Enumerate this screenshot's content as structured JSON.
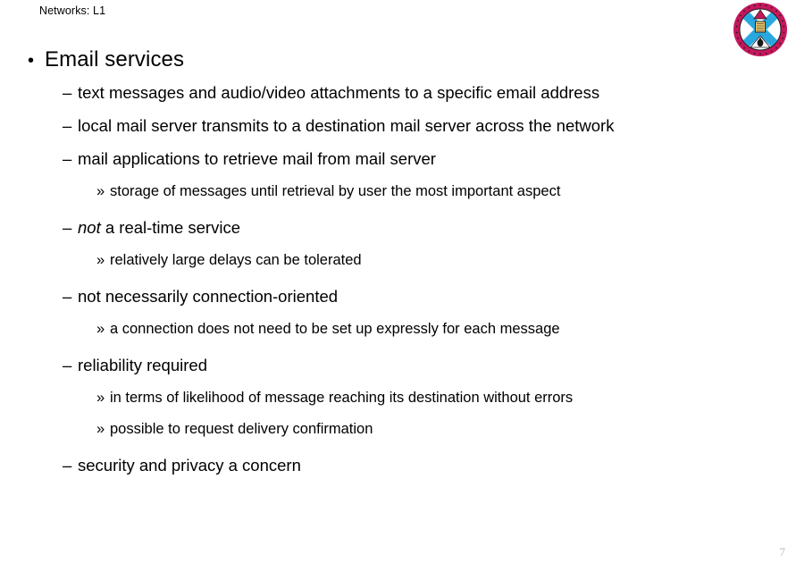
{
  "slide": {
    "header": "Networks: L1",
    "page_number": "7",
    "markers": {
      "level1": "•",
      "level2": "–",
      "level3": "»"
    },
    "logo": {
      "name": "university-of-edinburgh-crest",
      "ring_text_top": "THE UNIVERSITY",
      "ring_text_bottom": "OF EDINBURGH",
      "colors": {
        "ring": "#c4175c",
        "saltire_blue": "#29a8e0",
        "field_white": "#ffffff",
        "shield_gold": "#e8c46a",
        "outline": "#111111"
      }
    },
    "bullets": [
      {
        "level": 1,
        "text": "Email services"
      },
      {
        "level": 2,
        "text": "text messages and audio/video attachments to a specific email address"
      },
      {
        "level": 2,
        "text": "local mail server transmits to a destination mail server across the network"
      },
      {
        "level": 2,
        "text": "mail applications to retrieve mail from mail server"
      },
      {
        "level": 3,
        "text": "storage of messages until retrieval by user the most important aspect"
      },
      {
        "level": 2,
        "text_italic": "not",
        "text_rest": " a real-time service"
      },
      {
        "level": 3,
        "text": "relatively large delays can be tolerated"
      },
      {
        "level": 2,
        "text": "not necessarily connection-oriented"
      },
      {
        "level": 3,
        "text": "a connection does not need to be set up expressly for each message"
      },
      {
        "level": 2,
        "text": "reliability required"
      },
      {
        "level": 3,
        "text": "in terms of likelihood of message reaching its destination without errors"
      },
      {
        "level": 3,
        "text": "possible to request delivery confirmation"
      },
      {
        "level": 2,
        "text": "security and privacy a concern"
      }
    ]
  }
}
